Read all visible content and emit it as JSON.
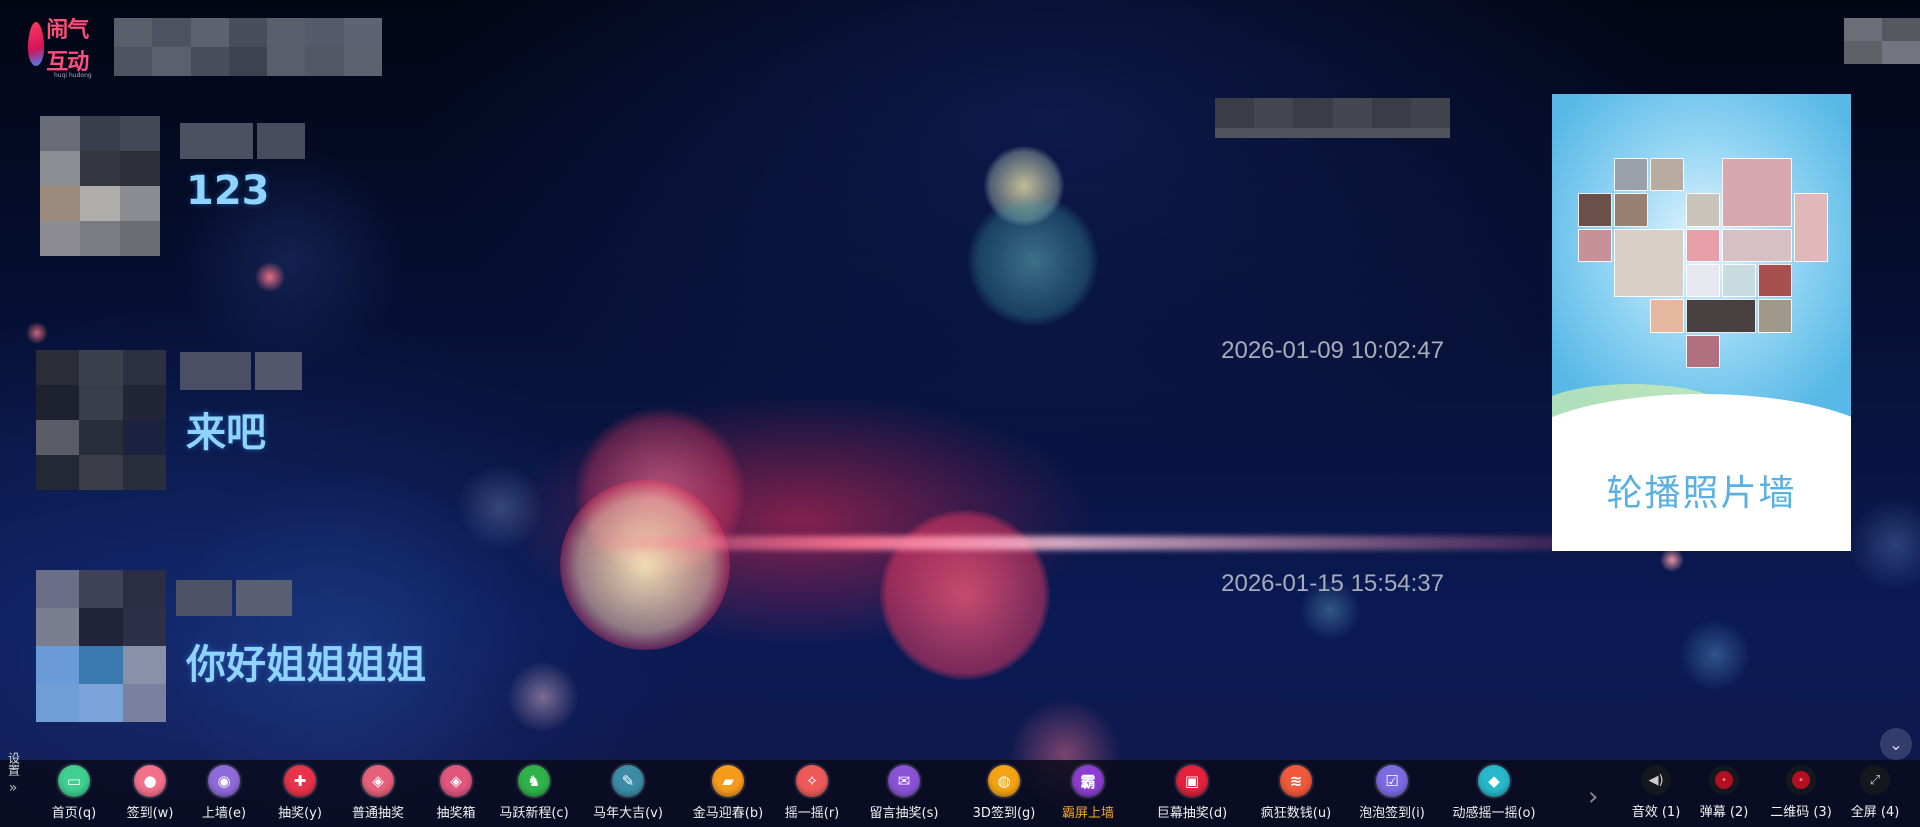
{
  "logo": {
    "text": "闹气互动",
    "sub": "huqi hudong"
  },
  "messages": [
    {
      "text": "123",
      "time": ""
    },
    {
      "text": "来吧",
      "time": "2026-01-09 10:02:47"
    },
    {
      "text": "你好姐姐姐姐",
      "time": "2026-01-15 15:54:37"
    }
  ],
  "photo_wall": {
    "title": "轮播照片墙"
  },
  "settings": {
    "label": "设置"
  },
  "toolbar": [
    {
      "label": "首页(q)",
      "icon": "home-icon",
      "color": "#3fcf8e",
      "glyph": "▭"
    },
    {
      "label": "签到(w)",
      "icon": "user-icon",
      "color": "#f2708a",
      "glyph": "●"
    },
    {
      "label": "上墙(e)",
      "icon": "chat-icon",
      "color": "#8e6ad8",
      "glyph": "◉"
    },
    {
      "label": "抽奖(y)",
      "icon": "gift-icon",
      "color": "#e8334a",
      "glyph": "✚"
    },
    {
      "label": "普通抽奖",
      "icon": "lottery-icon",
      "color": "#e5607a",
      "glyph": "◈"
    },
    {
      "label": "抽奖箱",
      "icon": "lottery-box-icon",
      "color": "#e0567e",
      "glyph": "◈"
    },
    {
      "label": "马跃新程(c)",
      "icon": "horse-icon",
      "color": "#2fb24a",
      "glyph": "♞"
    },
    {
      "label": "马年大吉(v)",
      "icon": "wrench-icon",
      "color": "#3c8ca8",
      "glyph": "✎"
    },
    {
      "label": "金马迎春(b)",
      "icon": "car-icon",
      "color": "#f59a1c",
      "glyph": "▰"
    },
    {
      "label": "摇一摇(r)",
      "icon": "shake-icon",
      "color": "#ee5a5a",
      "glyph": "✧"
    },
    {
      "label": "留言抽奖(s)",
      "icon": "message-icon",
      "color": "#8a52d6",
      "glyph": "✉"
    },
    {
      "label": "3D签到(g)",
      "icon": "globe-icon",
      "color": "#f3a313",
      "glyph": "◍"
    },
    {
      "label": "霸屏上墙",
      "icon": "barrage-icon",
      "color": "#8b3fd0",
      "glyph": "霸",
      "active": true
    },
    {
      "label": "巨幕抽奖(d)",
      "icon": "screen-icon",
      "color": "#e3213c",
      "glyph": "▣"
    },
    {
      "label": "疯狂数钱(u)",
      "icon": "money-icon",
      "color": "#f0583a",
      "glyph": "≋"
    },
    {
      "label": "泡泡签到(i)",
      "icon": "bubble-icon",
      "color": "#7b6be0",
      "glyph": "☑"
    },
    {
      "label": "动感摇一摇(o)",
      "icon": "diamond-icon",
      "color": "#27b8c9",
      "glyph": "◆"
    }
  ],
  "right_toolbar": [
    {
      "label": "音效 (1)",
      "icon": "sound-icon",
      "glyph": "◀)"
    },
    {
      "label": "弹幕 (2)",
      "icon": "danmaku-icon",
      "glyph": "●"
    },
    {
      "label": "二维码 (3)",
      "icon": "qrcode-icon",
      "glyph": "●"
    },
    {
      "label": "全屏 (4)",
      "icon": "fullscreen-icon",
      "glyph": "⤢"
    }
  ]
}
